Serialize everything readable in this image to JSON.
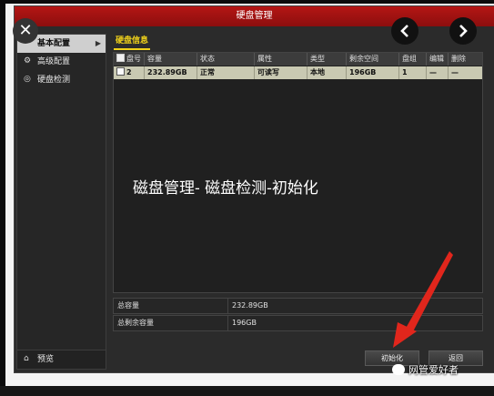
{
  "window": {
    "title": "硬盘管理"
  },
  "sidebar": {
    "items": [
      {
        "label": "基本配置",
        "icon": "gear-icon"
      },
      {
        "label": "高级配置",
        "icon": "settings-icon"
      },
      {
        "label": "硬盘检测",
        "icon": "disk-icon"
      }
    ],
    "preview_label": "预览",
    "preview_icon": "home-icon"
  },
  "main": {
    "section_title": "硬盘信息",
    "table": {
      "headers": [
        "盘号",
        "容量",
        "状态",
        "属性",
        "类型",
        "剩余空间",
        "盘组",
        "编辑",
        "删除"
      ],
      "rows": [
        [
          "2",
          "232.89GB",
          "正常",
          "可读写",
          "本地",
          "196GB",
          "1",
          "—",
          "—"
        ]
      ]
    },
    "summary": {
      "total_label": "总容量",
      "total_value": "232.89GB",
      "free_label": "总剩余容量",
      "free_value": "196GB"
    },
    "buttons": {
      "init_label": "初始化",
      "back_label": "返回"
    }
  },
  "overlay": {
    "caption": "磁盘管理- 磁盘检测-初始化",
    "watermark": "网管爱好者",
    "prev_icon": "chevron-left-icon",
    "next_icon": "chevron-right-icon",
    "close_icon": "close-icon",
    "arrow_color": "#e1261c"
  },
  "colors": {
    "titlebar": "#b41614",
    "accent": "#f1d21a",
    "selected_row": "#c9c9b2"
  }
}
